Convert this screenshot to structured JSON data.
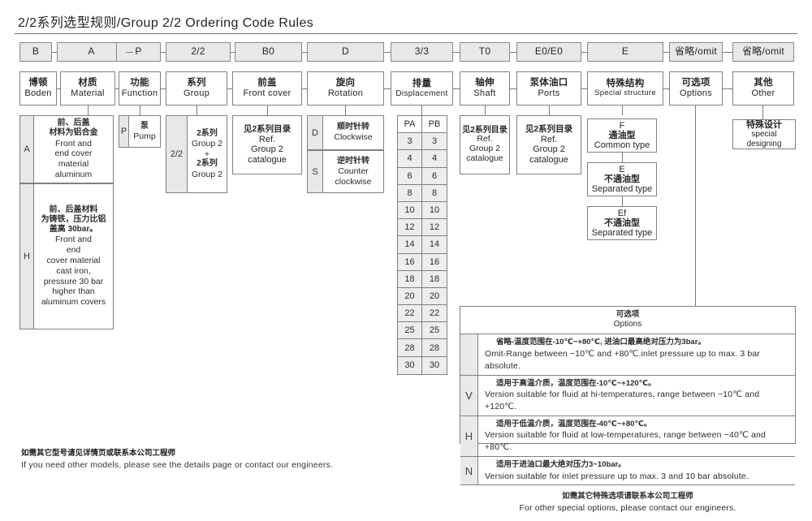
{
  "title": "2/2系列选型规则/Group 2/2 Ordering Code Rules",
  "code_row": [
    {
      "code": "B"
    },
    {
      "code": "A"
    },
    {
      "code": "P"
    },
    {
      "code": "2/2"
    },
    {
      "code": "B0"
    },
    {
      "code": "D"
    },
    {
      "code": "3/3"
    },
    {
      "code": "T0"
    },
    {
      "code": "E0/E0"
    },
    {
      "code": "E"
    },
    {
      "code": "省略/omit"
    },
    {
      "code": "省略/omit"
    }
  ],
  "name_row": [
    {
      "cn": "博顿",
      "en": "Boden"
    },
    {
      "cn": "材质",
      "en": "Material"
    },
    {
      "cn": "功能",
      "en": "Function"
    },
    {
      "cn": "系列",
      "en": "Group"
    },
    {
      "cn": "前盖",
      "en": "Front cover"
    },
    {
      "cn": "旋向",
      "en": "Rotation"
    },
    {
      "cn": "排量",
      "en": "Displacement"
    },
    {
      "cn": "轴伸",
      "en": "Shaft"
    },
    {
      "cn": "泵体油口",
      "en": "Ports"
    },
    {
      "cn": "特殊结构",
      "en": "Special structure"
    },
    {
      "cn": "可选项",
      "en": "Options"
    },
    {
      "cn": "其他",
      "en": "Other"
    }
  ],
  "material": {
    "options": [
      {
        "key": "A",
        "cn_lines": [
          "前、后盖",
          "材料为铝合金"
        ],
        "en_lines": [
          "Front and",
          "end cover",
          "material",
          "aluminum"
        ]
      },
      {
        "key": "H",
        "cn_lines": [
          "前、后盖材料",
          "为铸铁，压力比铝",
          "盖高 30bar。"
        ],
        "en_lines": [
          "Front and",
          "end",
          "cover material",
          "cast iron,",
          "pressure 30 bar",
          "higher than",
          "aluminum covers"
        ]
      }
    ]
  },
  "function": {
    "key": "P",
    "cn": "泵",
    "en": "Pump"
  },
  "group": {
    "key": "2/2",
    "lines": [
      "2系列",
      "Group 2",
      "+",
      "2系列",
      "Group 2"
    ]
  },
  "front_cover": {
    "lines": [
      "见2系列目录",
      "Ref.",
      "Group 2",
      "catalogue"
    ]
  },
  "rotation": {
    "options": [
      {
        "key": "D",
        "cn": "顺时针转",
        "en_lines": [
          "Clockwise"
        ]
      },
      {
        "key": "S",
        "cn": "逆时针转",
        "en_lines": [
          "Counter",
          "clockwise"
        ]
      }
    ]
  },
  "displacement": {
    "headers": [
      "PA",
      "PB"
    ],
    "rows": [
      [
        "3",
        "3"
      ],
      [
        "4",
        "4"
      ],
      [
        "6",
        "6"
      ],
      [
        "8",
        "8"
      ],
      [
        "10",
        "10"
      ],
      [
        "12",
        "12"
      ],
      [
        "14",
        "14"
      ],
      [
        "16",
        "16"
      ],
      [
        "18",
        "18"
      ],
      [
        "20",
        "20"
      ],
      [
        "22",
        "22"
      ],
      [
        "25",
        "25"
      ],
      [
        "28",
        "28"
      ],
      [
        "30",
        "30"
      ]
    ]
  },
  "shaft": {
    "lines": [
      "见2系列目录",
      "Ref.",
      "Group 2",
      "catalogue"
    ]
  },
  "ports": {
    "lines": [
      "见2系列目录",
      "Ref.",
      "Group 2",
      "catalogue"
    ]
  },
  "special_structure": {
    "items": [
      {
        "key": "F",
        "cn": "通油型",
        "en": "Common type"
      },
      {
        "key": "E",
        "cn": "不通油型",
        "en": "Separated type"
      },
      {
        "key": "Ef",
        "cn": "不通油型",
        "en": "Separated type"
      }
    ]
  },
  "other": {
    "cn": "特殊设计",
    "en": "special designing"
  },
  "options_table": {
    "head_cn": "可选项",
    "head_en": "Options",
    "rows": [
      {
        "key": "",
        "cn": "省略-温度范围在-10℃~+80℃, 进油口最高绝对压力为3bar。",
        "en": "Omit-Range between −10℃ and +80℃.inlet pressure up to max. 3 bar absolute."
      },
      {
        "key": "V",
        "cn": "适用于高温介质，温度范围在-10℃~+120℃。",
        "en": "Version suitable for fluid at hi-temperatures, range between −10℃ and +120℃."
      },
      {
        "key": "H",
        "cn": "适用于低温介质，温度范围在-40℃~+80℃。",
        "en": "Version suitable for fluid at low-temperatures, range between −40℃ and +80℃."
      },
      {
        "key": "N",
        "cn": "适用于进油口最大绝对压力3~10bar。",
        "en": "Version suitable for inlet pressure up to max. 3 and 10 bar absolute."
      }
    ],
    "foot_cn": "如需其它特殊选项请联系本公司工程师",
    "foot_en": "For other special options, please contact our engineers."
  },
  "footer": {
    "cn": "如需其它型号请见详情页或联系本公司工程师",
    "en": "If you need other models, please see the details page or contact our engineers."
  }
}
